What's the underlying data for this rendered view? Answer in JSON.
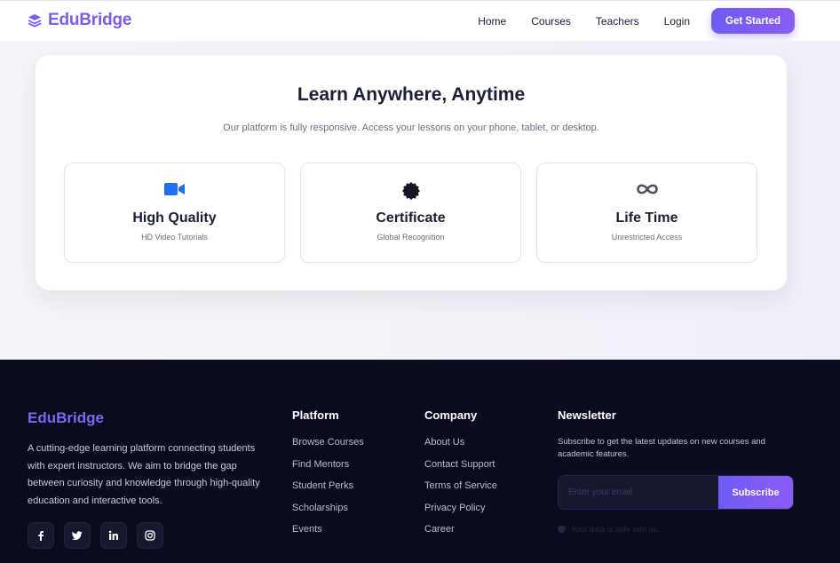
{
  "nav": {
    "brand": "EduBridge",
    "links": [
      "Home",
      "Courses",
      "Teachers",
      "Login"
    ],
    "cta": "Get Started"
  },
  "hero": {
    "title": "Learn Anywhere, Anytime",
    "subtitle": "Our platform is fully responsive. Access your lessons on your phone, tablet, or desktop.",
    "features": [
      {
        "icon": "video-camera-icon",
        "title": "High Quality",
        "subtitle": "HD Video Tutorials",
        "color": "#1f6ff0"
      },
      {
        "icon": "certificate-badge-icon",
        "title": "Certificate",
        "subtitle": "Global Recognition",
        "color": "#141628"
      },
      {
        "icon": "infinity-icon",
        "title": "Life Time",
        "subtitle": "Unrestricted Access",
        "color": "#4b5163"
      }
    ]
  },
  "footer": {
    "brand": "EduBridge",
    "description": "A cutting-edge learning platform connecting students with expert instructors. We aim to bridge the gap between curiosity and knowledge through high-quality education and interactive tools.",
    "socials": [
      "facebook-icon",
      "twitter-icon",
      "linkedin-icon",
      "instagram-icon"
    ],
    "platform": {
      "title": "Platform",
      "links": [
        "Browse Courses",
        "Find Mentors",
        "Student Perks",
        "Scholarships",
        "Events"
      ]
    },
    "company": {
      "title": "Company",
      "links": [
        "About Us",
        "Contact Support",
        "Terms of Service",
        "Privacy Policy",
        "Career"
      ]
    },
    "newsletter": {
      "title": "Newsletter",
      "text": "Subscribe to get the latest updates on new courses and academic features.",
      "placeholder": "Enter your email",
      "button": "Subscribe",
      "safe_note": "Your data is safe with us."
    }
  },
  "colors": {
    "accent": "#7a5cf0",
    "footer_bg": "#0a0b1f"
  }
}
